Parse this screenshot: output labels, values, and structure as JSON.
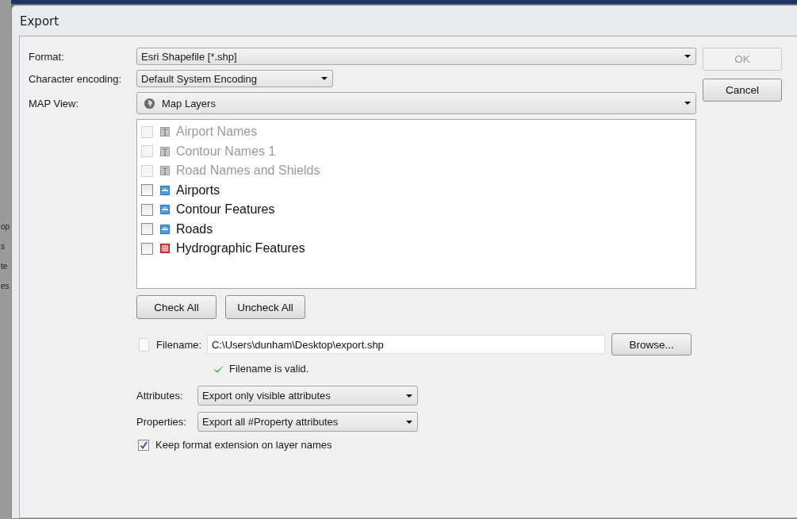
{
  "background_fragments": [
    "op",
    "s",
    "te",
    "es"
  ],
  "window": {
    "title": "Export"
  },
  "format": {
    "label": "Format:",
    "value": "Esri Shapefile [*.shp]"
  },
  "encoding": {
    "label": "Character encoding:",
    "value": "Default System Encoding"
  },
  "map_view": {
    "label": "MAP View:",
    "value": "Map Layers"
  },
  "layers": [
    {
      "name": "Airport Names",
      "kind": "text",
      "disabled": true,
      "checked": false
    },
    {
      "name": "Contour Names 1",
      "kind": "text",
      "disabled": true,
      "checked": false
    },
    {
      "name": "Road Names and Shields",
      "kind": "text",
      "disabled": true,
      "checked": false
    },
    {
      "name": "Airports",
      "kind": "line",
      "disabled": false,
      "checked": false
    },
    {
      "name": "Contour Features",
      "kind": "line",
      "disabled": false,
      "checked": false
    },
    {
      "name": "Roads",
      "kind": "line",
      "disabled": false,
      "checked": false
    },
    {
      "name": "Hydrographic Features",
      "kind": "area",
      "disabled": false,
      "checked": false
    }
  ],
  "list_buttons": [
    "Check All",
    "Uncheck All"
  ],
  "filename": {
    "label": "Filename:",
    "value": "C:\\Users\\dunham\\Desktop\\export.shp",
    "browse": "Browse...",
    "status": "Filename is valid."
  },
  "attributes": {
    "label": "Attributes:",
    "value": "Export only visible attributes"
  },
  "properties": {
    "label": "Properties:",
    "value": "Export all #Property attributes"
  },
  "keep_extension": {
    "label": "Keep format extension on layer names",
    "checked": true
  },
  "buttons": [
    {
      "label": "OK",
      "disabled": true
    },
    {
      "label": "Cancel",
      "disabled": false
    }
  ]
}
